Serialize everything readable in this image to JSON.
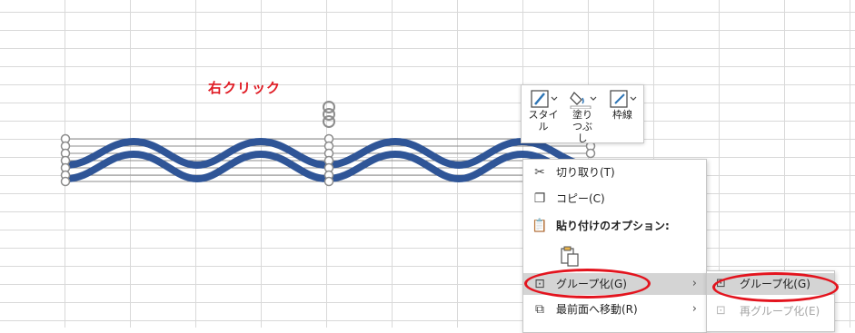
{
  "annotation": {
    "text": "右クリック",
    "color": "#e01b24"
  },
  "shape": {
    "stroke_color": "#2f5597"
  },
  "mini_toolbar": {
    "style_label": "スタイル",
    "fill_label": "塗りつぶし",
    "line_label": "枠線"
  },
  "context_menu": {
    "items": [
      {
        "label": "切り取り(T)",
        "icon": "scissors-icon"
      },
      {
        "label": "コピー(C)",
        "icon": "copy-icon"
      },
      {
        "label": "貼り付けのオプション:",
        "icon": "paste-icon"
      },
      {
        "label": "グループ化(G)",
        "icon": "group-icon",
        "has_submenu": true
      },
      {
        "label": "最前面へ移動(R)",
        "icon": "bring-to-front-icon",
        "has_submenu": true
      }
    ]
  },
  "submenu": {
    "items": [
      {
        "label": "グループ化(G)",
        "icon": "group-icon",
        "enabled": true
      },
      {
        "label": "再グループ化(E)",
        "icon": "regroup-icon",
        "enabled": false
      }
    ]
  },
  "highlight_color": "#e3141e"
}
